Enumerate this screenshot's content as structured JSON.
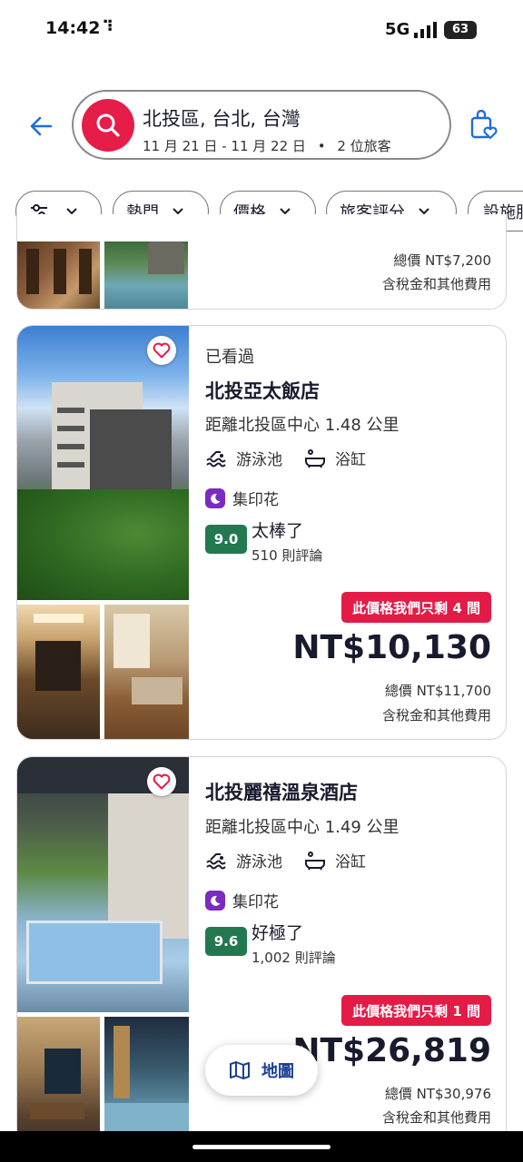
{
  "status_bar": {
    "time": "14:42",
    "network": "5G",
    "battery": "63"
  },
  "search": {
    "destination": "北投區, 台北, 台灣",
    "dates": "11 月 21 日 - 11 月 22 日",
    "separator": "•",
    "guests": "2 位旅客"
  },
  "filters": [
    {
      "label": "",
      "icon": "sliders-icon"
    },
    {
      "label": "熱門"
    },
    {
      "label": "價格"
    },
    {
      "label": "旅客評分"
    },
    {
      "label": "設施服"
    }
  ],
  "prev_card": {
    "total": "總價 NT$7,200",
    "tax": "含稅金和其他費用"
  },
  "hotels": [
    {
      "seen": "已看過",
      "name": "北投亞太飯店",
      "distance": "距離北投區中心 1.48 公里",
      "amenities": [
        "游泳池",
        "浴缸"
      ],
      "stamp": "集印花",
      "score": "9.0",
      "rating_label": "太棒了",
      "reviews": "510 則評論",
      "badge": "此價格我們只剩 4 間",
      "price": "NT$10,130",
      "total": "總價 NT$11,700",
      "tax": "含稅金和其他費用"
    },
    {
      "name": "北投麗禧溫泉酒店",
      "distance": "距離北投區中心 1.49 公里",
      "amenities": [
        "游泳池",
        "浴缸"
      ],
      "stamp": "集印花",
      "score": "9.6",
      "rating_label": "好極了",
      "reviews": "1,002 則評論",
      "badge": "此價格我們只剩 1 間",
      "price": "NT$26,819",
      "total": "總價 NT$30,976",
      "tax": "含稅金和其他費用"
    }
  ],
  "map_button": {
    "label": "地圖"
  },
  "colors": {
    "brand_red": "#e51d48",
    "badge_red": "#e41b47",
    "score_green": "#227950",
    "stamp_purple": "#7b2cbf",
    "link_blue": "#1c3f94"
  }
}
